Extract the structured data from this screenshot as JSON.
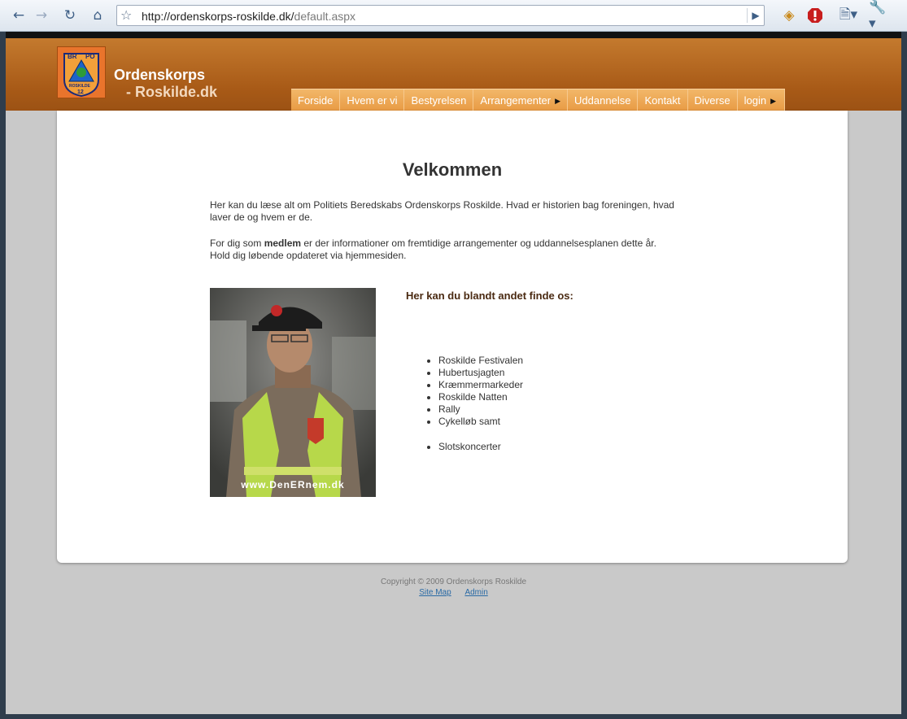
{
  "browser": {
    "url_host": "http://ordenskorps-roskilde.dk/",
    "url_path": "default.aspx",
    "icons": [
      "back-icon",
      "forward-icon",
      "reload-icon",
      "home-icon",
      "bookmark-star-icon",
      "go-icon",
      "extension-icon",
      "stop-extension-icon",
      "page-menu-icon",
      "wrench-icon"
    ]
  },
  "site": {
    "title": "Ordenskorps",
    "subtitle": "- Roskilde.dk",
    "logo_lines": [
      "BR",
      "PO",
      "ROSKILDE",
      "12"
    ]
  },
  "nav": {
    "items": [
      {
        "label": "Forside",
        "has_arrow": false
      },
      {
        "label": "Hvem er vi",
        "has_arrow": false
      },
      {
        "label": "Bestyrelsen",
        "has_arrow": false
      },
      {
        "label": "Arrangementer",
        "has_arrow": true
      },
      {
        "label": "Uddannelse",
        "has_arrow": false
      },
      {
        "label": "Kontakt",
        "has_arrow": false
      },
      {
        "label": "Diverse",
        "has_arrow": false
      },
      {
        "label": "login",
        "has_arrow": true
      }
    ]
  },
  "main": {
    "heading": "Velkommen",
    "intro": "Her kan du læse alt om Politiets Beredskabs Ordenskorps Roskilde. Hvad er historien bag foreningen, hvad laver de og hvem er de.",
    "member_pre": "For dig som ",
    "member_bold": "medlem",
    "member_post": " er der informationer om fremtidige arrangementer og uddannelsesplanen dette år.",
    "member_line2": "Hold dig løbende opdateret via hjemmesiden.",
    "photo_caption": "www.DenERnem.dk",
    "find_heading": "Her kan du blandt andet finde os:",
    "find_list": [
      "Roskilde Festivalen",
      "Hubertusjagten",
      "Kræmmermarkeder",
      "Roskilde Natten",
      "Rally",
      "Cykelløb samt"
    ],
    "find_list2": [
      "Slotskoncerter"
    ]
  },
  "footer": {
    "copyright": "Copyright © 2009 Ordenskorps Roskilde",
    "links": [
      "Site Map",
      "Admin"
    ]
  },
  "colors": {
    "header_orange": "#a85a17",
    "nav_orange": "#e89a43",
    "page_gray": "#c9c9c9",
    "heading_brown": "#4a2a12"
  }
}
